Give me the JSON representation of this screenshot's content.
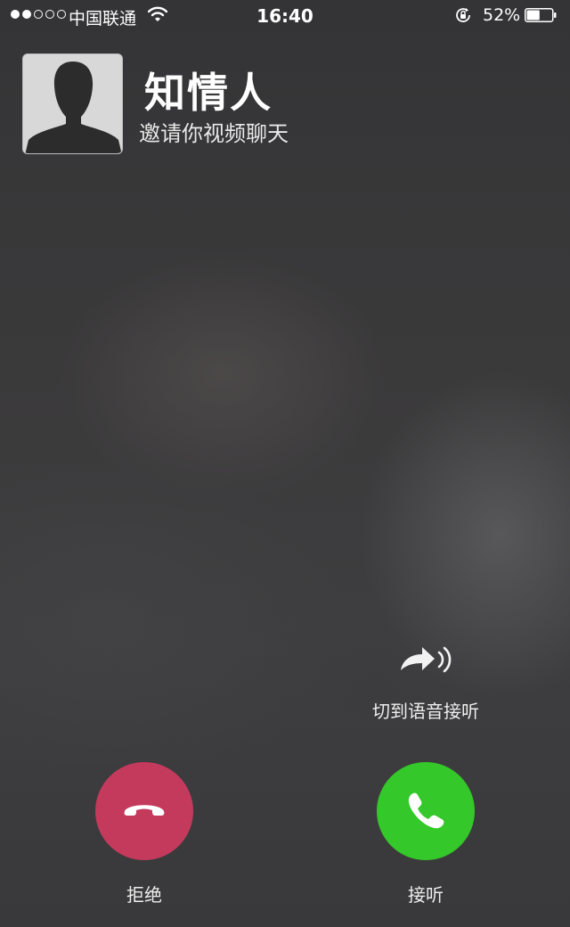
{
  "status_bar": {
    "signal_bars_filled": 2,
    "signal_bars_total": 5,
    "carrier": "中国联通",
    "time": "16:40",
    "battery_percent": "52%",
    "battery_level": 0.52
  },
  "caller": {
    "name": "知情人",
    "subtitle": "邀请你视频聊天"
  },
  "actions": {
    "switch_to_voice_label": "切到语音接听",
    "decline_label": "拒绝",
    "accept_label": "接听"
  },
  "colors": {
    "decline": "#c43a5d",
    "accept": "#35c82a"
  },
  "icons": {
    "avatar": "default-person-silhouette",
    "voice_switch": "arrow-with-sound-waves",
    "decline": "phone-hangup",
    "accept": "phone-handset"
  }
}
